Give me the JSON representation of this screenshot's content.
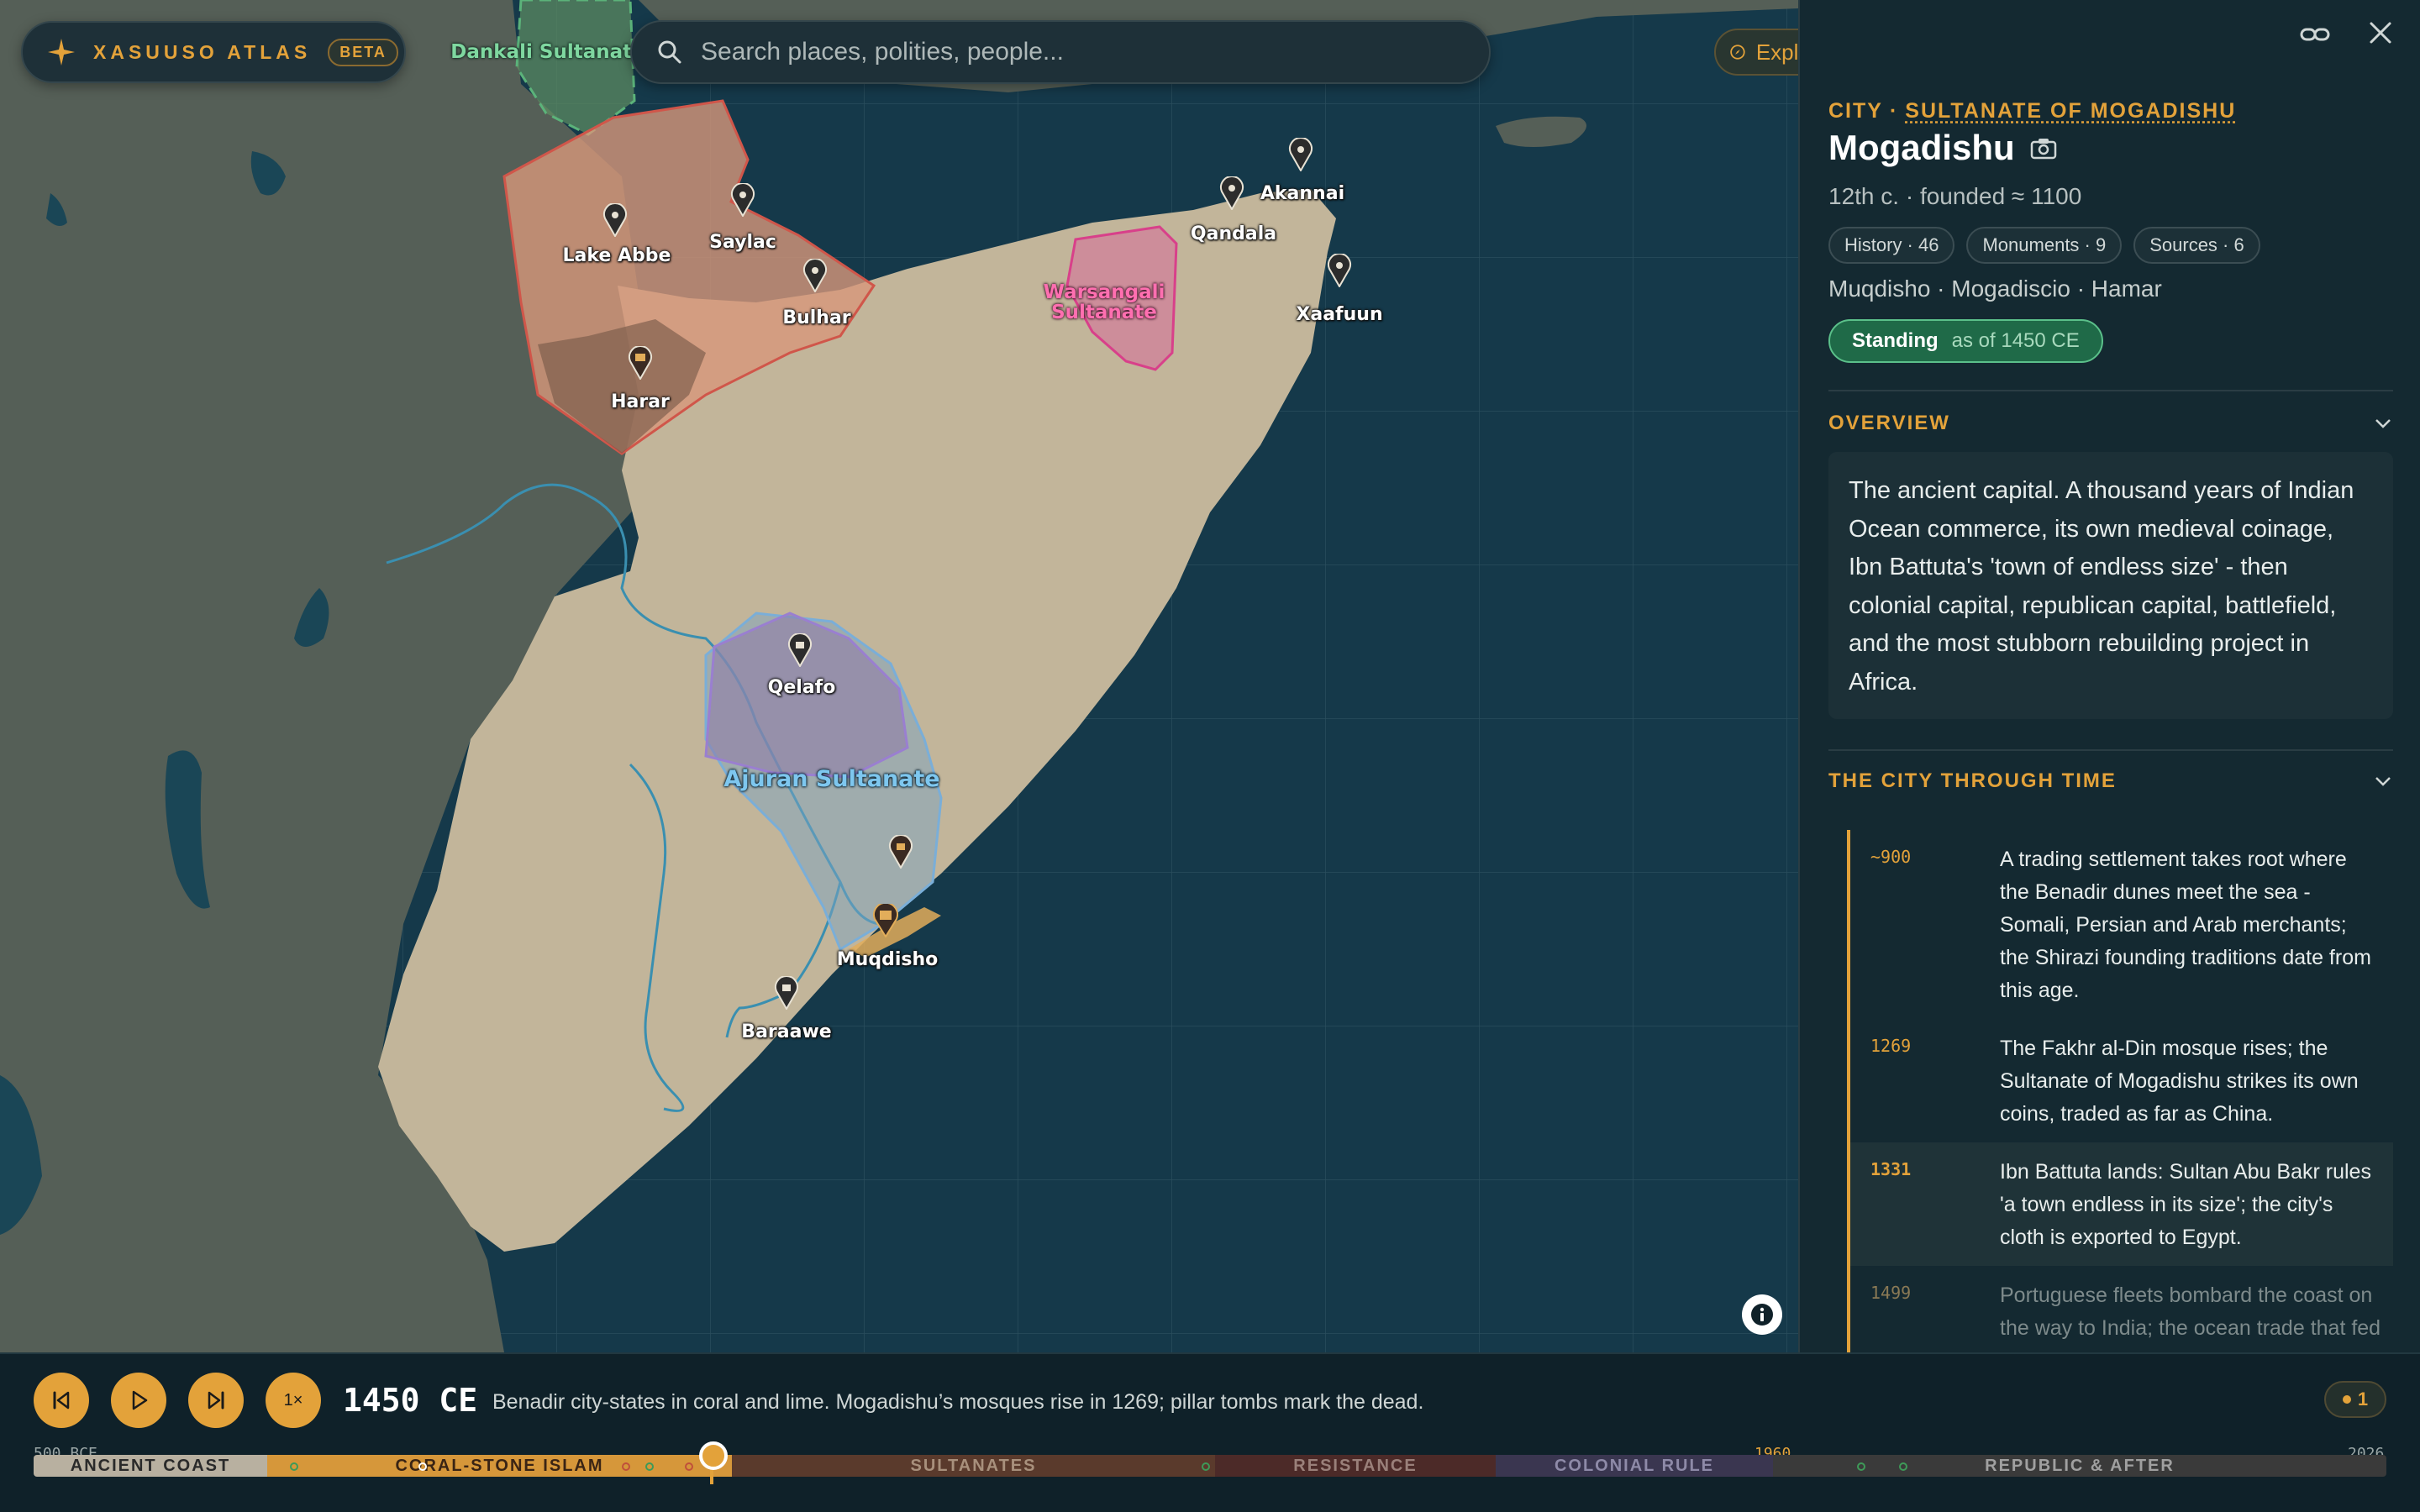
{
  "brand": {
    "name": "XASUUSO ATLAS",
    "badge": "BETA"
  },
  "search": {
    "placeholder": "Search places, polities, people..."
  },
  "explore": {
    "label": "Explore"
  },
  "map": {
    "places": [
      {
        "name": "Lake Abbe",
        "icon": "pin-icon"
      },
      {
        "name": "Saylac",
        "icon": "pin-icon"
      },
      {
        "name": "Bulhar",
        "icon": "pin-icon"
      },
      {
        "name": "Harar",
        "icon": "walled-city-icon"
      },
      {
        "name": "Qandala",
        "icon": "pin-icon"
      },
      {
        "name": "Akannai",
        "icon": "pin-icon"
      },
      {
        "name": "Xaafuun",
        "icon": "pin-icon"
      },
      {
        "name": "Qelafo",
        "icon": "town-icon"
      },
      {
        "name": "Muqdisho",
        "icon": "capital-icon"
      },
      {
        "name": "Baraawe",
        "icon": "town-icon"
      }
    ],
    "polities": [
      {
        "name": "Dankali Sultanate",
        "color": "#3fa66b"
      },
      {
        "name": "Warsangali Sultanate",
        "color": "#d8408a"
      },
      {
        "name": "Ajuran Sultanate",
        "color": "#5b9ac6"
      }
    ]
  },
  "panel": {
    "type": "CITY",
    "polity": "SULTANATE OF MOGADISHU",
    "title": "Mogadishu",
    "subtitle": "12th c. · founded ≈ 1100",
    "chips": [
      "History · 46",
      "Monuments · 9",
      "Sources · 6"
    ],
    "aliases": "Muqdisho · Mogadiscio · Hamar",
    "status": {
      "label": "Standing",
      "as_of": "as of 1450 CE",
      "color": "#1f6a48"
    },
    "overview_heading": "OVERVIEW",
    "overview": "The ancient capital. A thousand years of Indian Ocean commerce, its own medieval coinage, Ibn Battuta's 'town of endless size' - then colonial capital, republican capital, battlefield, and the most stubborn rebuilding project in Africa.",
    "timeline_heading": "THE CITY THROUGH TIME",
    "timeline": [
      {
        "year": "~900",
        "text": "A trading settlement takes root where the Benadir dunes meet the sea - Somali, Persian and Arab merchants; the Shirazi founding traditions date from this age."
      },
      {
        "year": "1269",
        "text": "The Fakhr al-Din mosque rises; the Sultanate of Mogadishu strikes its own coins, traded as far as China."
      },
      {
        "year": "1331",
        "text": "Ibn Battuta lands: Sultan Abu Bakr rules 'a town endless in its size'; the city's cloth is exported to Egypt."
      },
      {
        "year": "1499",
        "text": "Portuguese fleets bombard the coast on the way to India; the ocean trade that fed the city begins to shift."
      }
    ]
  },
  "player": {
    "speed": "1×",
    "year": "1450 CE",
    "description": "Benadir city-states in coral and lime. Mogadishu’s mosques rise in 1269; pillar tombs mark the dead.",
    "marker_count": "1"
  },
  "timeline_bar": {
    "start": "500 BCE",
    "mid": "1960",
    "end": "2026",
    "current_year": 1450,
    "eras": [
      {
        "label": "ANCIENT COAST",
        "color": "#b8b0a0"
      },
      {
        "label": "CORAL-STONE ISLAM",
        "color": "#d6973a"
      },
      {
        "label": "SULTANATES",
        "color": "#5a3a2c"
      },
      {
        "label": "RESISTANCE",
        "color": "#4c2a28"
      },
      {
        "label": "COLONIAL RULE",
        "color": "#3a3650"
      },
      {
        "label": "REPUBLIC & AFTER",
        "color": "#3a3a3a"
      }
    ]
  }
}
